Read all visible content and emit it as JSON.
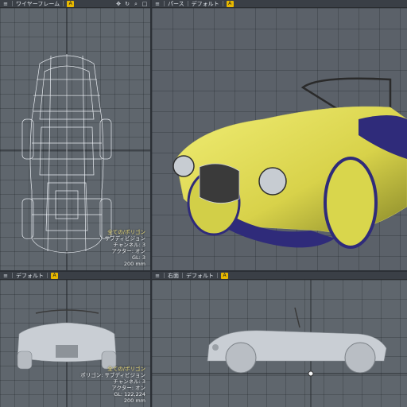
{
  "viewports": {
    "top_left": {
      "tab_view": "ワイヤーフレーム",
      "stats": [
        "全ての/ポリゴン",
        "サブディビジョン",
        "チャンネル: 3",
        "アクター: オン",
        "GL: 3",
        "200 mm"
      ]
    },
    "top_right": {
      "tab_view": "パース",
      "tab_shading": "デフォルト"
    },
    "bottom_left": {
      "tab_view": "デフォルト",
      "stats": [
        "全ての/ポリゴン",
        "ポリゴン: サブディビジョン",
        "チャンネル: 3",
        "アクター: オン",
        "GL: 122,224",
        "200 mm"
      ]
    },
    "bottom_right": {
      "tab_view": "右面",
      "tab_shading": "デフォルト"
    }
  },
  "icons": {
    "view_toggle": "A",
    "header_menu": "⌄"
  },
  "colors": {
    "viewport_bg": "#5f666d",
    "body_yellow": "#e3e05a",
    "wire": "#e9edf2",
    "shadow_blue": "#2f2b7a"
  }
}
